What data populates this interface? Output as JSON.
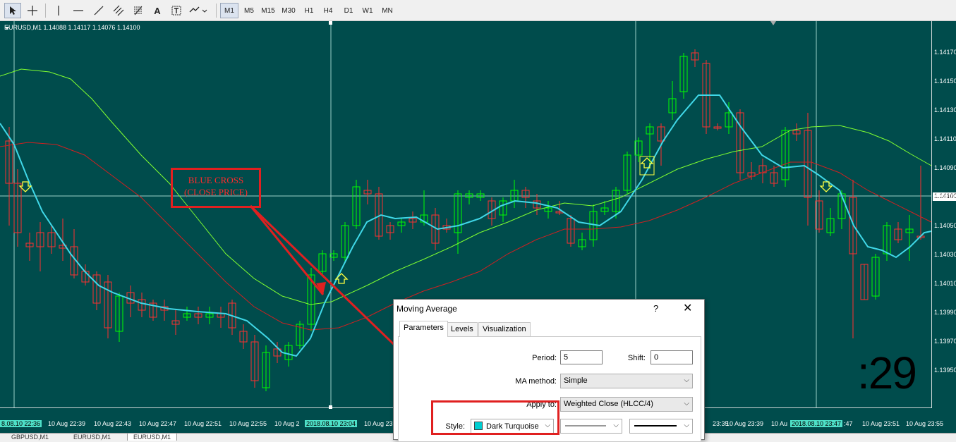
{
  "toolbar": {
    "icons": [
      "cursor-icon",
      "crosshair-icon",
      "vertical-line-icon",
      "horizontal-line-icon",
      "trendline-icon",
      "equidistant-channel-icon",
      "fibonacci-retracement-icon",
      "text-icon",
      "text-label-icon",
      "arrow-objects-icon"
    ],
    "text_tool": "A",
    "timeframes": [
      "M1",
      "M5",
      "M15",
      "M30",
      "H1",
      "H4",
      "D1",
      "W1",
      "MN"
    ],
    "active_timeframe": "M1"
  },
  "chart": {
    "title": "EURUSD,M1  1.14088 1.14117 1.14076 1.14100",
    "background": "#004c4c",
    "bull_color": "#00ff00",
    "bear_color": "#ff3030",
    "ma_colors": [
      "#40d8e8",
      "#80ff30",
      "#d02020"
    ],
    "price_axis": [
      "1.14170",
      "1.14150",
      "1.14130",
      "1.14110",
      "1.14090",
      "1.14070",
      "1.14050",
      "1.14030",
      "1.14010",
      "1.13990",
      "1.13970",
      "1.13950"
    ],
    "current_price": "1.14100",
    "time_axis": [
      "8.08.10 22:36",
      "10 Aug 22:39",
      "10 Aug 22:43",
      "10 Aug 22:47",
      "10 Aug 22:51",
      "10 Aug 22:55",
      "10 Aug 2",
      "2018.08.10 23:04",
      "10 Aug 23:",
      "23:35",
      "10 Aug 23:39",
      "10 Au",
      "2018.08.10 23:47",
      ":47",
      "10 Aug 23:51",
      "10 Aug 23:55"
    ],
    "countdown": ":29",
    "annotation_line1": "BLUE CROSS",
    "annotation_line2": "(CLOSE PRICE)"
  },
  "tabs": [
    "GBPUSD,M1",
    "EURUSD,M1",
    "EURUSD,M1"
  ],
  "dialog": {
    "title": "Moving Average",
    "help": "?",
    "close": "✕",
    "tabs": [
      "Parameters",
      "Levels",
      "Visualization"
    ],
    "period_label": "Period:",
    "period_value": "5",
    "shift_label": "Shift:",
    "shift_value": "0",
    "method_label": "MA method:",
    "method_value": "Simple",
    "apply_label": "Apply to:",
    "apply_value": "Weighted Close (HLCC/4)",
    "style_label": "Style:",
    "style_color_name": "Dark Turquoise",
    "style_color": "#00ced1"
  }
}
